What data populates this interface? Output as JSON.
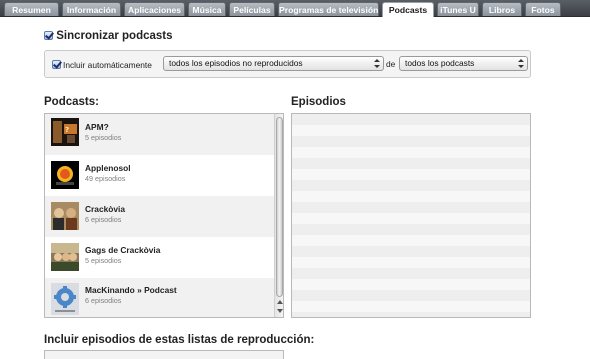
{
  "tabs": [
    {
      "label": "Resumen",
      "active": false
    },
    {
      "label": "Información",
      "active": false
    },
    {
      "label": "Aplicaciones",
      "active": false
    },
    {
      "label": "Música",
      "active": false
    },
    {
      "label": "Películas",
      "active": false
    },
    {
      "label": "Programas de televisión",
      "active": false
    },
    {
      "label": "Podcasts",
      "active": true
    },
    {
      "label": "iTunes U",
      "active": false
    },
    {
      "label": "Libros",
      "active": false
    },
    {
      "label": "Fotos",
      "active": false
    }
  ],
  "sync": {
    "label": "Sincronizar podcasts",
    "checked": true,
    "auto_include_label": "Incluir automáticamente",
    "auto_include_checked": true,
    "episodes_select": "todos los episodios no reproducidos",
    "de_label": "de",
    "podcasts_select": "todos los podcasts"
  },
  "podcasts": {
    "heading": "Podcasts:",
    "items": [
      {
        "title": "APM?",
        "subtitle": "5 episodios",
        "icon": "apm-artwork"
      },
      {
        "title": "Applenosol",
        "subtitle": "49 episodios",
        "icon": "applenosol-artwork"
      },
      {
        "title": "Crackòvia",
        "subtitle": "6 episodios",
        "icon": "crackovia-artwork"
      },
      {
        "title": "Gags de Crackòvia",
        "subtitle": "5 episodios",
        "icon": "gags-crackovia-artwork"
      },
      {
        "title": "MacKinando » Podcast",
        "subtitle": "6 episodios",
        "icon": "mackinando-artwork"
      }
    ]
  },
  "episodes": {
    "heading": "Episodios"
  },
  "playlists": {
    "heading": "Incluir episodios de estas listas de reproducción:"
  },
  "colors": {
    "tabbar": "#4a4f55",
    "active_tab": "#ffffff",
    "panel_border": "#b9b9b9",
    "row_alt": "#f1f1f1"
  }
}
